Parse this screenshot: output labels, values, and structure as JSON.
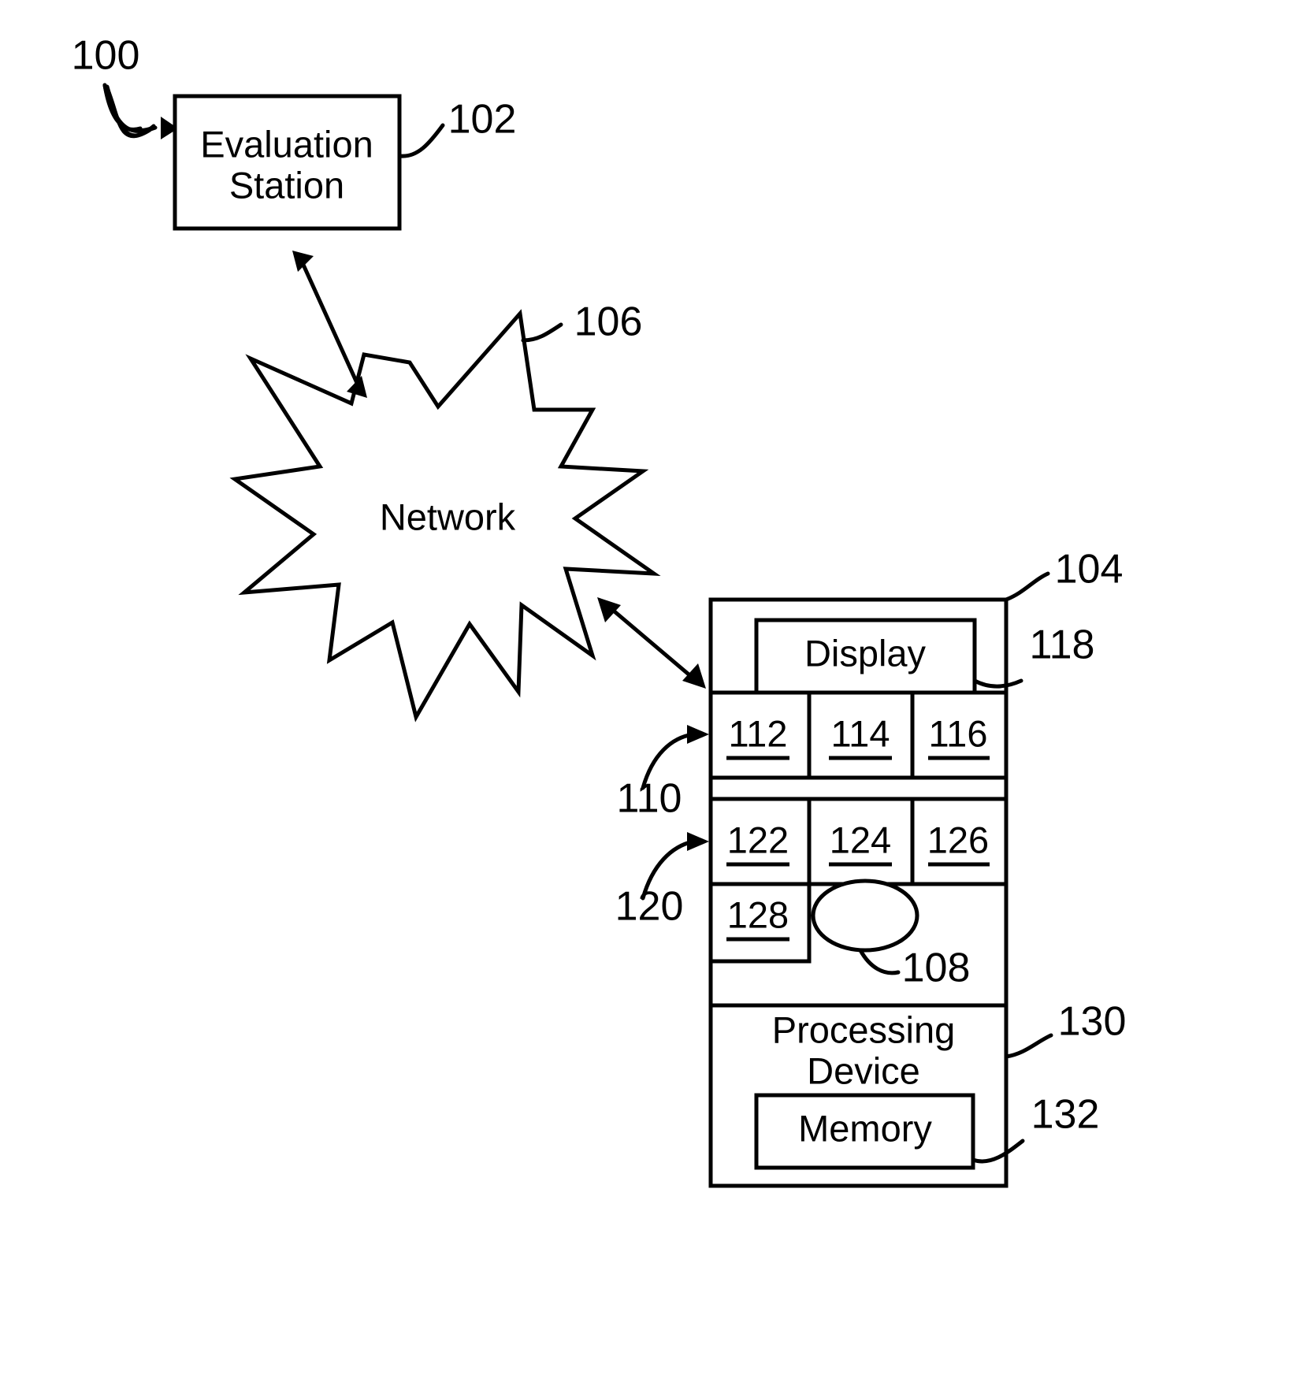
{
  "figure": {
    "system_ref": "100",
    "nodes": {
      "evaluation_station": {
        "label_line1": "Evaluation",
        "label_line2": "Station",
        "ref": "102"
      },
      "network": {
        "label": "Network",
        "ref": "106"
      },
      "client_device": {
        "ref": "104"
      },
      "display": {
        "label": "Display",
        "ref": "118"
      },
      "processing_device": {
        "label_line1": "Processing",
        "label_line2": "Device",
        "ref": "130"
      },
      "memory": {
        "label": "Memory",
        "ref": "132"
      },
      "ellipse": {
        "ref": "108"
      }
    },
    "group_refs": {
      "first_row_group": "110",
      "second_row_group": "120"
    },
    "first_row_items": [
      "112",
      "114",
      "116"
    ],
    "second_row_items": [
      "122",
      "124",
      "126"
    ],
    "third_row_items": [
      "128"
    ],
    "colors": {
      "ink": "#000000",
      "paper": "#ffffff"
    }
  }
}
